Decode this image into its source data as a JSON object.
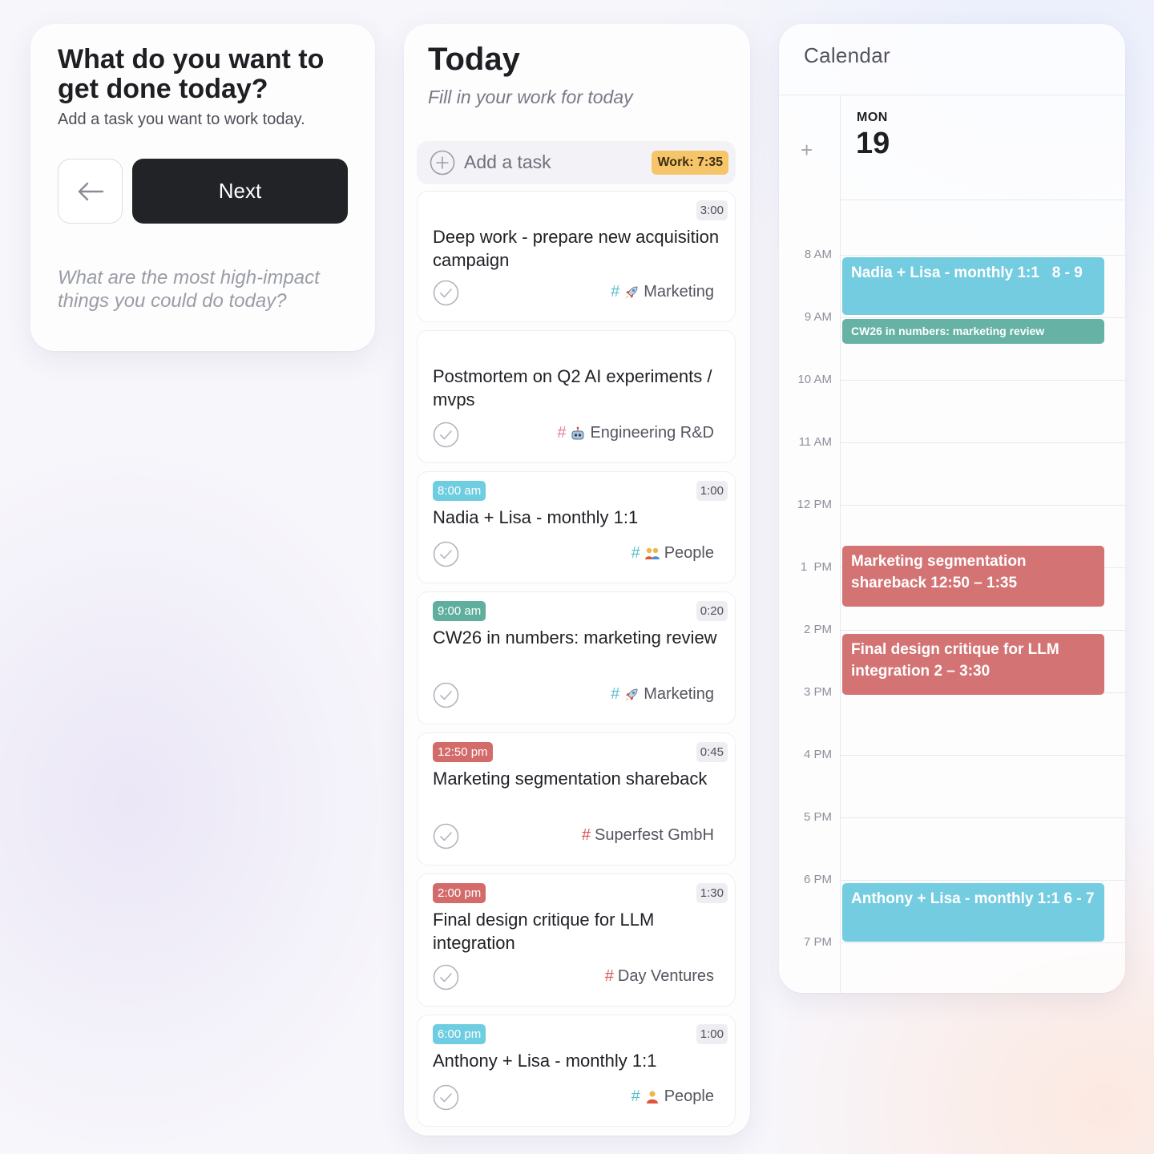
{
  "intro": {
    "title": "What do you want to get done today?",
    "subtitle": "Add a task you want to work today.",
    "back_button": "left-arrow-icon",
    "next_label": "Next",
    "hint": "What are the most high-impact things you could do today?"
  },
  "today": {
    "title": "Today",
    "subtitle": "Fill in your work for today",
    "add_task_label": "Add a task",
    "work_badge": "Work: 7:35",
    "tasks": [
      {
        "time": "",
        "duration": "3:00",
        "title": "Deep work - prepare new acquisition campaign",
        "tag": "Marketing",
        "tag_icon": "rocket-icon",
        "hash_color": "#5bbfce"
      },
      {
        "time": "",
        "duration": "",
        "title": "Postmortem on Q2 AI experiments / mvps",
        "tag": "Engineering R&D",
        "tag_icon": "robot-icon",
        "hash_color": "#e37e9b"
      },
      {
        "time": "8:00 am",
        "time_color": "#6ecde0",
        "duration": "1:00",
        "title": "Nadia + Lisa - monthly 1:1",
        "tag": "People",
        "tag_icon": "people-icon",
        "hash_color": "#5bbfce"
      },
      {
        "time": "9:00 am",
        "time_color": "#5fae9e",
        "duration": "0:20",
        "title": "CW26 in numbers: marketing review",
        "tag": "Marketing",
        "tag_icon": "rocket-icon",
        "hash_color": "#5bbfce"
      },
      {
        "time": "12:50 pm",
        "time_color": "#d46b6b",
        "duration": "0:45",
        "title": "Marketing segmentation shareback",
        "tag": "Superfest GmbH",
        "tag_icon": "",
        "hash_color": "#d9534f"
      },
      {
        "time": "2:00 pm",
        "time_color": "#d46b6b",
        "duration": "1:30",
        "title": "Final design critique for LLM integration",
        "tag": "Day Ventures",
        "tag_icon": "",
        "hash_color": "#d9534f"
      },
      {
        "time": "6:00 pm",
        "time_color": "#6ecde0",
        "duration": "1:00",
        "title": "Anthony + Lisa - monthly 1:1",
        "tag": "People",
        "tag_icon": "person-icon",
        "hash_color": "#5bbfce"
      }
    ]
  },
  "calendar": {
    "title": "Calendar",
    "add_icon": "plus-icon",
    "day_of_week": "MON",
    "day_number": "19",
    "hours": [
      "8 AM",
      "9 AM",
      "10 AM",
      "11 AM",
      "12 PM",
      "1  PM",
      "2 PM",
      "3 PM",
      "4 PM",
      "5 PM",
      "6 PM",
      "7 PM"
    ],
    "events": [
      {
        "text": "Nadia + Lisa - monthly 1:1   8 - 9",
        "color": "#74cce0"
      },
      {
        "text": "CW26 in numbers: marketing review",
        "color": "#66b2a4"
      },
      {
        "text": "Marketing segmentation shareback 12:50 – 1:35",
        "color": "#d47373"
      },
      {
        "text": "Final design critique for LLM integration 2 – 3:30",
        "color": "#d47373"
      },
      {
        "text": "Anthony + Lisa - monthly 1:1 6 - 7",
        "color": "#74cce0"
      }
    ]
  }
}
